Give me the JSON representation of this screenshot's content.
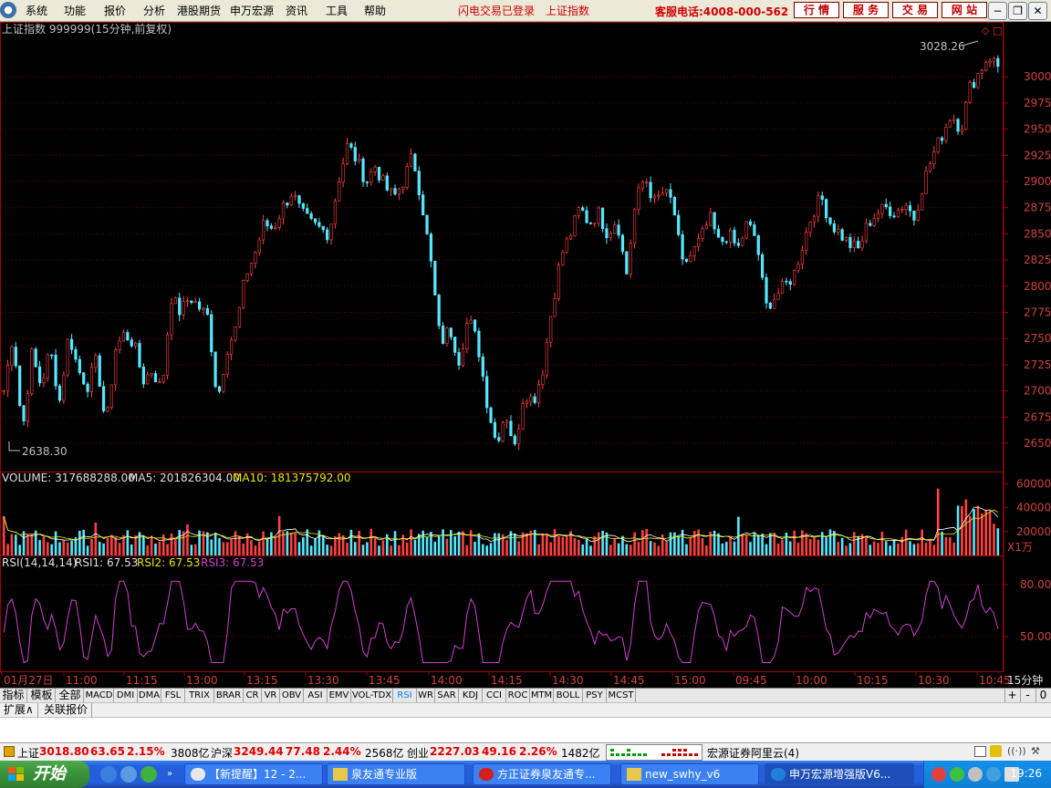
{
  "menubar": {
    "items": [
      "系统",
      "功能",
      "报价",
      "分析",
      "港股期货",
      "申万宏源",
      "资讯",
      "工具",
      "帮助"
    ],
    "status_login": "闪电交易已登录",
    "status_index": "上证指数",
    "hotline": "客服电话:4008-000-562",
    "top_buttons": [
      "行 情",
      "服 务",
      "交 易",
      "网 站"
    ]
  },
  "chart_header": {
    "title": "上证指数 999999(15分钟,前复权)"
  },
  "price_panel": {
    "high_label": "3028.26",
    "low_label": "2638.30",
    "y_ticks": [
      "3000",
      "2975",
      "2950",
      "2925",
      "2900",
      "2875",
      "2850",
      "2825",
      "2800",
      "2775",
      "2750",
      "2725",
      "2700",
      "2675",
      "2650"
    ]
  },
  "volume_panel": {
    "label_volume": "VOLUME: 317688288.00",
    "label_ma5": "MA5: 201826304.00",
    "label_ma10": "MA10: 181375792.00",
    "y_ticks": [
      "60000",
      "40000",
      "20000"
    ],
    "unit": "X1万"
  },
  "rsi_panel": {
    "label_name": "RSI(14,14,14)",
    "label_rsi1": "RSI1: 67.53",
    "label_rsi2": "RSI2: 67.53",
    "label_rsi3": "RSI3: 67.53",
    "y_ticks": [
      "80.00",
      "50.00"
    ]
  },
  "time_axis": {
    "labels": [
      "01月27日",
      "11:00",
      "11:15",
      "13:00",
      "13:15",
      "13:30",
      "13:45",
      "14:00",
      "14:15",
      "14:30",
      "14:45",
      "15:00",
      "09:45",
      "10:00",
      "10:15",
      "10:30",
      "10:45"
    ],
    "period": "15分钟"
  },
  "chart_data": {
    "type": "candlestick",
    "symbol": "上证指数 999999",
    "period": "15分钟",
    "high": 3028.26,
    "low": 2638.3,
    "ylim": [
      2630,
      3035
    ],
    "y_ticks": [
      3000,
      2975,
      2950,
      2925,
      2900,
      2875,
      2850,
      2825,
      2800,
      2775,
      2750,
      2725,
      2700,
      2675,
      2650
    ],
    "close_path": [
      2700,
      2755,
      2660,
      2735,
      2705,
      2740,
      2690,
      2755,
      2720,
      2705,
      2730,
      2665,
      2740,
      2755,
      2745,
      2710,
      2720,
      2700,
      2790,
      2775,
      2790,
      2780,
      2770,
      2690,
      2740,
      2760,
      2810,
      2830,
      2860,
      2855,
      2875,
      2890,
      2870,
      2860,
      2855,
      2850,
      2900,
      2935,
      2920,
      2900,
      2915,
      2895,
      2885,
      2900,
      2925,
      2880,
      2820,
      2745,
      2760,
      2730,
      2770,
      2745,
      2690,
      2650,
      2680,
      2645,
      2700,
      2690,
      2720,
      2780,
      2830,
      2850,
      2875,
      2860,
      2870,
      2850,
      2865,
      2810,
      2880,
      2905,
      2880,
      2890,
      2880,
      2820,
      2830,
      2845,
      2865,
      2840,
      2850,
      2835,
      2860,
      2845,
      2780,
      2790,
      2800,
      2810,
      2840,
      2870,
      2885,
      2860,
      2850,
      2840,
      2835,
      2860,
      2870,
      2875,
      2870,
      2880,
      2865,
      2900,
      2925,
      2945,
      2965,
      2950,
      2990,
      3005,
      3020,
      3010
    ],
    "volume_unit": "X1万",
    "volume_ylim": [
      0,
      65000
    ],
    "volume_ticks": [
      60000,
      40000,
      20000
    ],
    "rsi_ylim": [
      30,
      90
    ],
    "rsi_ticks": [
      80,
      50
    ],
    "rsi_values": {
      "RSI1": 67.53,
      "RSI2": 67.53,
      "RSI3": 67.53
    }
  },
  "indicator_tabs": {
    "groups": [
      "指标",
      "模板",
      "全部"
    ],
    "items": [
      "MACD",
      "DMI",
      "DMA",
      "FSL",
      "TRIX",
      "BRAR",
      "CR",
      "VR",
      "OBV",
      "ASI",
      "EMV",
      "VOL-TDX",
      "RSI",
      "WR",
      "SAR",
      "KDJ",
      "CCI",
      "ROC",
      "MTM",
      "BOLL",
      "PSY",
      "MCST"
    ],
    "active": "RSI",
    "controls": [
      "+",
      "-",
      "0"
    ]
  },
  "ext_bar": {
    "items": [
      "扩展∧",
      "关联报价"
    ]
  },
  "status_bar": {
    "sh_label": "上证",
    "sh_price": "3018.80",
    "sh_change": "63.65",
    "sh_pct": "2.15%",
    "sh_amount": "3808亿",
    "hs_label": "沪深",
    "hs_price": "3249.44",
    "hs_change": "77.48",
    "hs_pct": "2.44%",
    "hs_amount": "2568亿",
    "cy_label": "创业",
    "cy_price": "2227.03",
    "cy_change": "49.16",
    "cy_pct": "2.26%",
    "cy_amount": "1482亿",
    "server": "宏源证券阿里云(4)"
  },
  "taskbar": {
    "start": "开始",
    "buttons": [
      "【新提醒】12 - 2...",
      "泉友通专业版",
      "方正证券泉友通专...",
      "new_swhy_v6",
      "申万宏源增强版V6..."
    ],
    "clock": "19:26"
  }
}
